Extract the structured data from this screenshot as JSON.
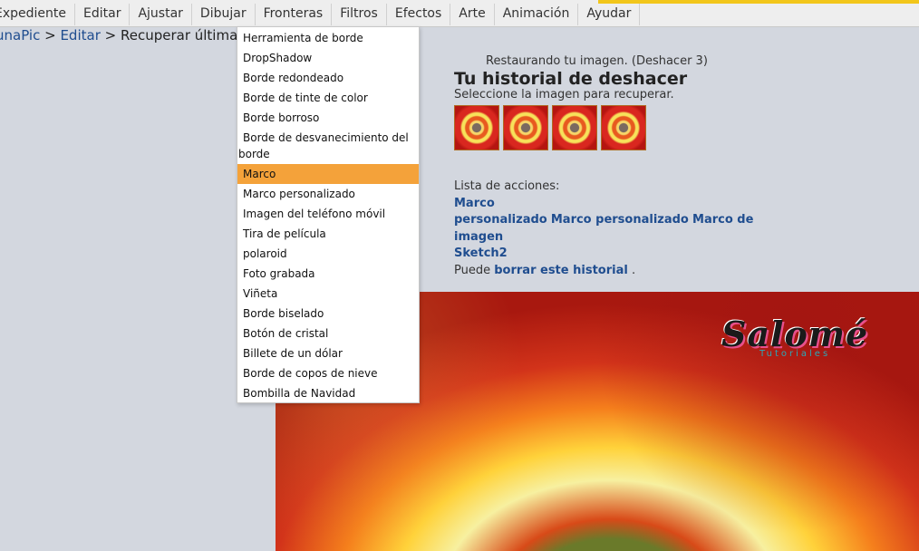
{
  "menubar": {
    "items": [
      "Expediente",
      "Editar",
      "Ajustar",
      "Dibujar",
      "Fronteras",
      "Filtros",
      "Efectos",
      "Arte",
      "Animación",
      "Ayudar"
    ]
  },
  "breadcrumb": {
    "root": "unaPic",
    "sep1": " > ",
    "edit": "Editar",
    "sep2": " > Recuperar última im"
  },
  "dropdown": {
    "items": [
      "Herramienta de borde",
      "DropShadow",
      "Borde redondeado",
      "Borde de tinte de color",
      "Borde borroso",
      "Borde de desvanecimiento del borde",
      "Marco",
      "Marco personalizado",
      "Imagen del teléfono móvil",
      "Tira de película",
      "polaroid",
      "Foto grabada",
      "Viñeta",
      "Borde biselado",
      "Botón de cristal",
      "Billete de un dólar",
      "Borde de copos de nieve",
      "Bombilla de Navidad"
    ],
    "wrap_line1": "Borde de desvanecimiento del",
    "wrap_line2": "borde",
    "active_index": 6,
    "active_color": "#f4a23a"
  },
  "history": {
    "restoring": "Restaurando tu imagen. (Deshacer 3)",
    "title": "Tu historial de deshacer",
    "subtitle": "Seleccione la imagen para recuperar.",
    "thumbnail_count": 4
  },
  "actions": {
    "label": "Lista de acciones:",
    "line1": "Marco",
    "line2a": "personalizado",
    "line2b": "Marco personalizado",
    "line2c": "Marco de",
    "line3": "imagen",
    "line4": "Sketch2",
    "footer_pre": "Puede ",
    "footer_link": "borrar este historial",
    "footer_post": " ."
  },
  "logo": {
    "main": "Salomé",
    "sub": "Tutoriales"
  },
  "colors": {
    "page_bg": "#d3d7df",
    "link": "#1f4d8f",
    "accent_bar": "#f2c61a"
  }
}
